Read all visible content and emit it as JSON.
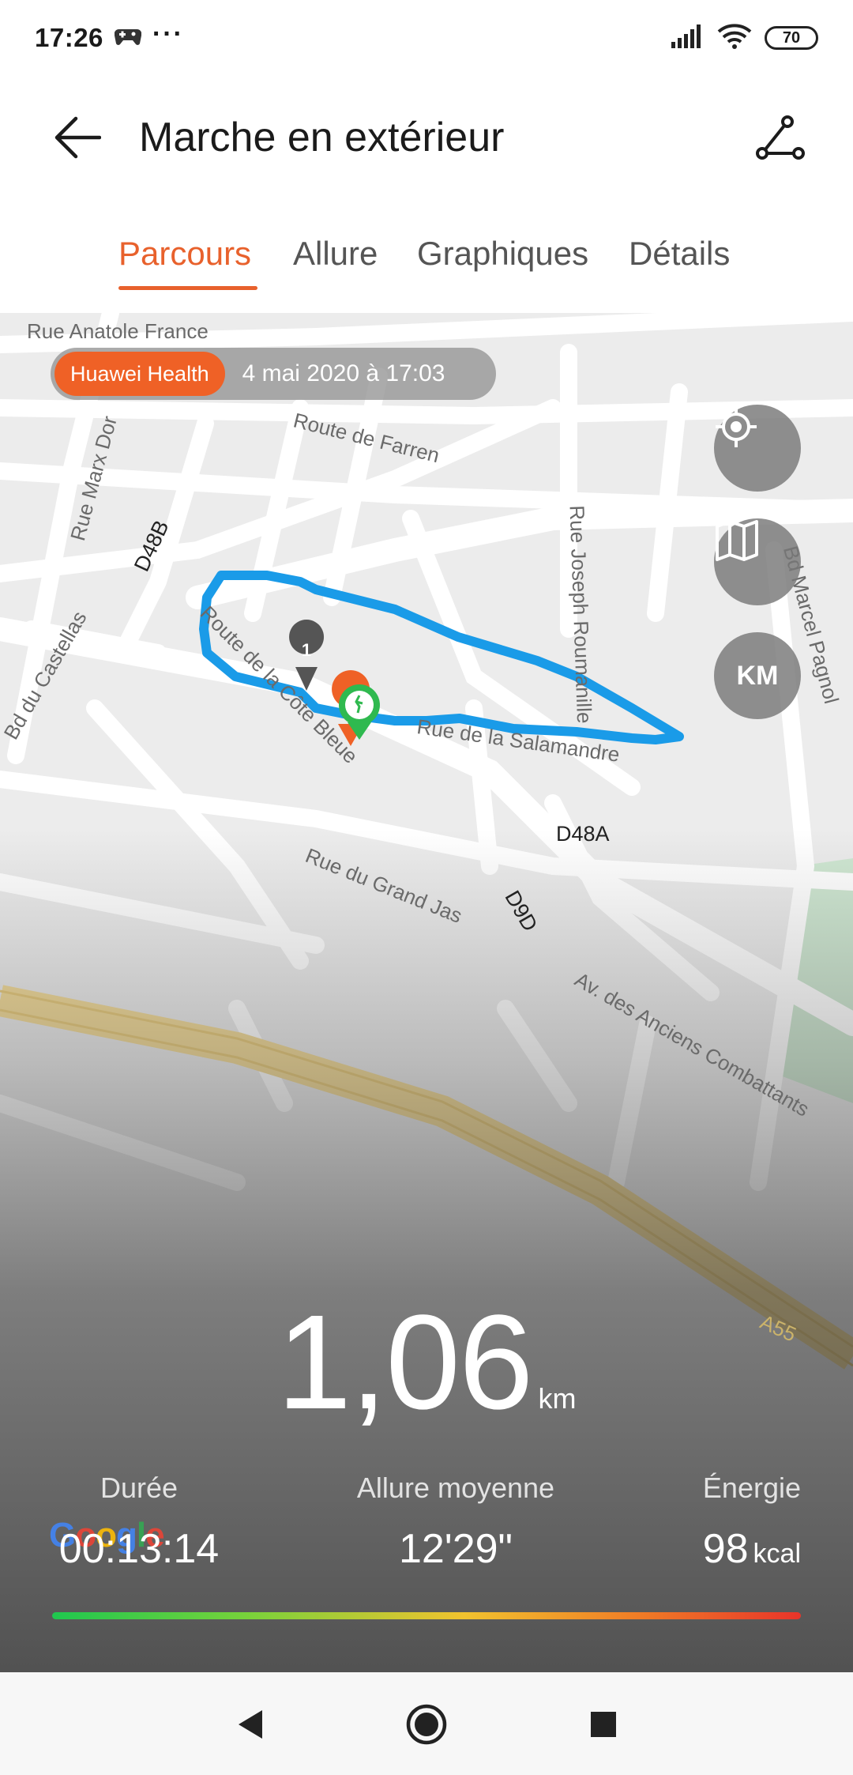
{
  "status_bar": {
    "time": "17:26",
    "battery": "70",
    "more": "···"
  },
  "app_bar": {
    "title": "Marche en extérieur"
  },
  "tabs": [
    {
      "label": "Parcours",
      "active": true
    },
    {
      "label": "Allure",
      "active": false
    },
    {
      "label": "Graphiques",
      "active": false
    },
    {
      "label": "Détails",
      "active": false
    }
  ],
  "map": {
    "source_tag": "Huawei Health",
    "date": "4 mai 2020 à 17:03",
    "controls": {
      "units_label": "KM"
    },
    "marker_number": "1",
    "streets": [
      "Rue Anatole France",
      "Route de Farren",
      "Rue Marx Dor",
      "D48B",
      "Rue Joseph Roumanille",
      "Bd Marcel Pagnol",
      "Bd du Castellas",
      "Route de la Côte Bleue",
      "D48A",
      "Rue du Grand Jas",
      "D9D",
      "Av. des Anciens Combattants",
      "Rue de la Salamandre",
      "A55"
    ],
    "attribution": "Google",
    "route_color": "#1a9be8",
    "accent_color": "#ef6126"
  },
  "stats": {
    "distance_value": "1,06",
    "distance_unit": "km",
    "duration_label": "Durée",
    "duration_value": "00:13:14",
    "pace_label": "Allure moyenne",
    "pace_value": "12'29\"",
    "energy_label": "Énergie",
    "energy_value": "98",
    "energy_unit": "kcal"
  }
}
